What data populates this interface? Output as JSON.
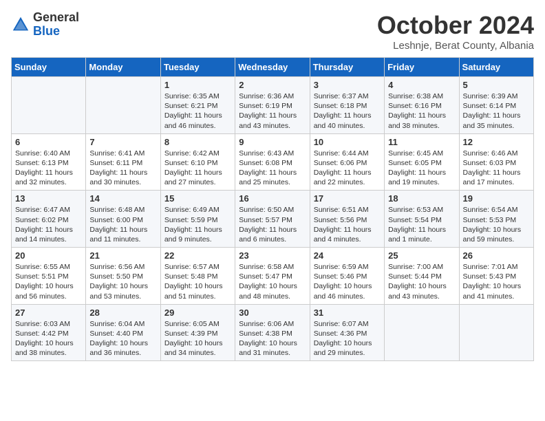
{
  "header": {
    "logo_general": "General",
    "logo_blue": "Blue",
    "month_title": "October 2024",
    "subtitle": "Leshnje, Berat County, Albania"
  },
  "days_of_week": [
    "Sunday",
    "Monday",
    "Tuesday",
    "Wednesday",
    "Thursday",
    "Friday",
    "Saturday"
  ],
  "weeks": [
    [
      {
        "day": "",
        "sunrise": "",
        "sunset": "",
        "daylight": ""
      },
      {
        "day": "",
        "sunrise": "",
        "sunset": "",
        "daylight": ""
      },
      {
        "day": "1",
        "sunrise": "Sunrise: 6:35 AM",
        "sunset": "Sunset: 6:21 PM",
        "daylight": "Daylight: 11 hours and 46 minutes."
      },
      {
        "day": "2",
        "sunrise": "Sunrise: 6:36 AM",
        "sunset": "Sunset: 6:19 PM",
        "daylight": "Daylight: 11 hours and 43 minutes."
      },
      {
        "day": "3",
        "sunrise": "Sunrise: 6:37 AM",
        "sunset": "Sunset: 6:18 PM",
        "daylight": "Daylight: 11 hours and 40 minutes."
      },
      {
        "day": "4",
        "sunrise": "Sunrise: 6:38 AM",
        "sunset": "Sunset: 6:16 PM",
        "daylight": "Daylight: 11 hours and 38 minutes."
      },
      {
        "day": "5",
        "sunrise": "Sunrise: 6:39 AM",
        "sunset": "Sunset: 6:14 PM",
        "daylight": "Daylight: 11 hours and 35 minutes."
      }
    ],
    [
      {
        "day": "6",
        "sunrise": "Sunrise: 6:40 AM",
        "sunset": "Sunset: 6:13 PM",
        "daylight": "Daylight: 11 hours and 32 minutes."
      },
      {
        "day": "7",
        "sunrise": "Sunrise: 6:41 AM",
        "sunset": "Sunset: 6:11 PM",
        "daylight": "Daylight: 11 hours and 30 minutes."
      },
      {
        "day": "8",
        "sunrise": "Sunrise: 6:42 AM",
        "sunset": "Sunset: 6:10 PM",
        "daylight": "Daylight: 11 hours and 27 minutes."
      },
      {
        "day": "9",
        "sunrise": "Sunrise: 6:43 AM",
        "sunset": "Sunset: 6:08 PM",
        "daylight": "Daylight: 11 hours and 25 minutes."
      },
      {
        "day": "10",
        "sunrise": "Sunrise: 6:44 AM",
        "sunset": "Sunset: 6:06 PM",
        "daylight": "Daylight: 11 hours and 22 minutes."
      },
      {
        "day": "11",
        "sunrise": "Sunrise: 6:45 AM",
        "sunset": "Sunset: 6:05 PM",
        "daylight": "Daylight: 11 hours and 19 minutes."
      },
      {
        "day": "12",
        "sunrise": "Sunrise: 6:46 AM",
        "sunset": "Sunset: 6:03 PM",
        "daylight": "Daylight: 11 hours and 17 minutes."
      }
    ],
    [
      {
        "day": "13",
        "sunrise": "Sunrise: 6:47 AM",
        "sunset": "Sunset: 6:02 PM",
        "daylight": "Daylight: 11 hours and 14 minutes."
      },
      {
        "day": "14",
        "sunrise": "Sunrise: 6:48 AM",
        "sunset": "Sunset: 6:00 PM",
        "daylight": "Daylight: 11 hours and 11 minutes."
      },
      {
        "day": "15",
        "sunrise": "Sunrise: 6:49 AM",
        "sunset": "Sunset: 5:59 PM",
        "daylight": "Daylight: 11 hours and 9 minutes."
      },
      {
        "day": "16",
        "sunrise": "Sunrise: 6:50 AM",
        "sunset": "Sunset: 5:57 PM",
        "daylight": "Daylight: 11 hours and 6 minutes."
      },
      {
        "day": "17",
        "sunrise": "Sunrise: 6:51 AM",
        "sunset": "Sunset: 5:56 PM",
        "daylight": "Daylight: 11 hours and 4 minutes."
      },
      {
        "day": "18",
        "sunrise": "Sunrise: 6:53 AM",
        "sunset": "Sunset: 5:54 PM",
        "daylight": "Daylight: 11 hours and 1 minute."
      },
      {
        "day": "19",
        "sunrise": "Sunrise: 6:54 AM",
        "sunset": "Sunset: 5:53 PM",
        "daylight": "Daylight: 10 hours and 59 minutes."
      }
    ],
    [
      {
        "day": "20",
        "sunrise": "Sunrise: 6:55 AM",
        "sunset": "Sunset: 5:51 PM",
        "daylight": "Daylight: 10 hours and 56 minutes."
      },
      {
        "day": "21",
        "sunrise": "Sunrise: 6:56 AM",
        "sunset": "Sunset: 5:50 PM",
        "daylight": "Daylight: 10 hours and 53 minutes."
      },
      {
        "day": "22",
        "sunrise": "Sunrise: 6:57 AM",
        "sunset": "Sunset: 5:48 PM",
        "daylight": "Daylight: 10 hours and 51 minutes."
      },
      {
        "day": "23",
        "sunrise": "Sunrise: 6:58 AM",
        "sunset": "Sunset: 5:47 PM",
        "daylight": "Daylight: 10 hours and 48 minutes."
      },
      {
        "day": "24",
        "sunrise": "Sunrise: 6:59 AM",
        "sunset": "Sunset: 5:46 PM",
        "daylight": "Daylight: 10 hours and 46 minutes."
      },
      {
        "day": "25",
        "sunrise": "Sunrise: 7:00 AM",
        "sunset": "Sunset: 5:44 PM",
        "daylight": "Daylight: 10 hours and 43 minutes."
      },
      {
        "day": "26",
        "sunrise": "Sunrise: 7:01 AM",
        "sunset": "Sunset: 5:43 PM",
        "daylight": "Daylight: 10 hours and 41 minutes."
      }
    ],
    [
      {
        "day": "27",
        "sunrise": "Sunrise: 6:03 AM",
        "sunset": "Sunset: 4:42 PM",
        "daylight": "Daylight: 10 hours and 38 minutes."
      },
      {
        "day": "28",
        "sunrise": "Sunrise: 6:04 AM",
        "sunset": "Sunset: 4:40 PM",
        "daylight": "Daylight: 10 hours and 36 minutes."
      },
      {
        "day": "29",
        "sunrise": "Sunrise: 6:05 AM",
        "sunset": "Sunset: 4:39 PM",
        "daylight": "Daylight: 10 hours and 34 minutes."
      },
      {
        "day": "30",
        "sunrise": "Sunrise: 6:06 AM",
        "sunset": "Sunset: 4:38 PM",
        "daylight": "Daylight: 10 hours and 31 minutes."
      },
      {
        "day": "31",
        "sunrise": "Sunrise: 6:07 AM",
        "sunset": "Sunset: 4:36 PM",
        "daylight": "Daylight: 10 hours and 29 minutes."
      },
      {
        "day": "",
        "sunrise": "",
        "sunset": "",
        "daylight": ""
      },
      {
        "day": "",
        "sunrise": "",
        "sunset": "",
        "daylight": ""
      }
    ]
  ]
}
